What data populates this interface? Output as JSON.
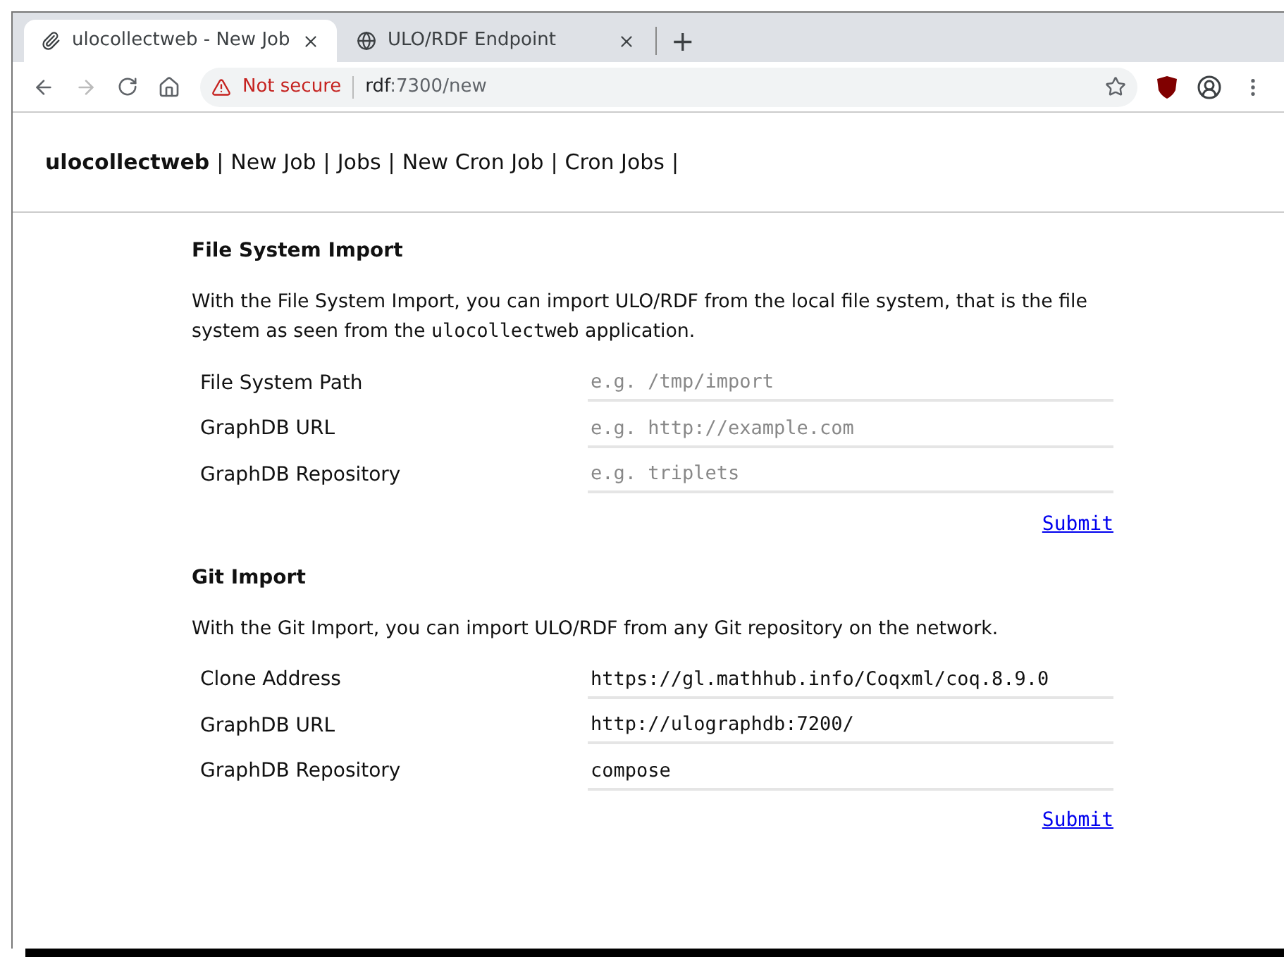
{
  "browser": {
    "tabs": [
      {
        "title": "ulocollectweb - New Job",
        "selected": true,
        "kind": "paperclip"
      },
      {
        "title": "ULO/RDF Endpoint",
        "selected": false,
        "kind": "globe"
      }
    ],
    "new_tab": "+",
    "security": "Not secure",
    "url_host": "rdf",
    "url_path": ":7300/new"
  },
  "nav": {
    "brand": "ulocollectweb",
    "separator": "|",
    "links": [
      "New Job",
      "Jobs",
      "New Cron Job",
      "Cron Jobs"
    ]
  },
  "sections": [
    {
      "title": "File System Import",
      "description": [
        {
          "kind": "text",
          "text": "With the File System Import, you can import ULO/RDF from the local file system, that is the file system as seen from the "
        },
        {
          "kind": "code",
          "text": "ulocollectweb"
        },
        {
          "kind": "text",
          "text": " application."
        }
      ],
      "fields": [
        {
          "label": "File System Path",
          "placeholder": "e.g. /tmp/import"
        },
        {
          "label": "GraphDB URL",
          "placeholder": "e.g. http://example.com"
        },
        {
          "label": "GraphDB Repository",
          "placeholder": "e.g. triplets"
        }
      ],
      "submit": "Submit"
    },
    {
      "title": "Git Import",
      "description": [
        {
          "kind": "text",
          "text": "With the Git Import, you can import ULO/RDF from any Git repository on the network."
        }
      ],
      "fields": [
        {
          "label": "Clone Address",
          "value": "https://gl.mathhub.info/Coqxml/coq.8.9.0"
        },
        {
          "label": "GraphDB URL",
          "value": "http://ulographdb:7200/"
        },
        {
          "label": "GraphDB Repository",
          "value": "compose"
        }
      ],
      "submit": "Submit"
    }
  ]
}
